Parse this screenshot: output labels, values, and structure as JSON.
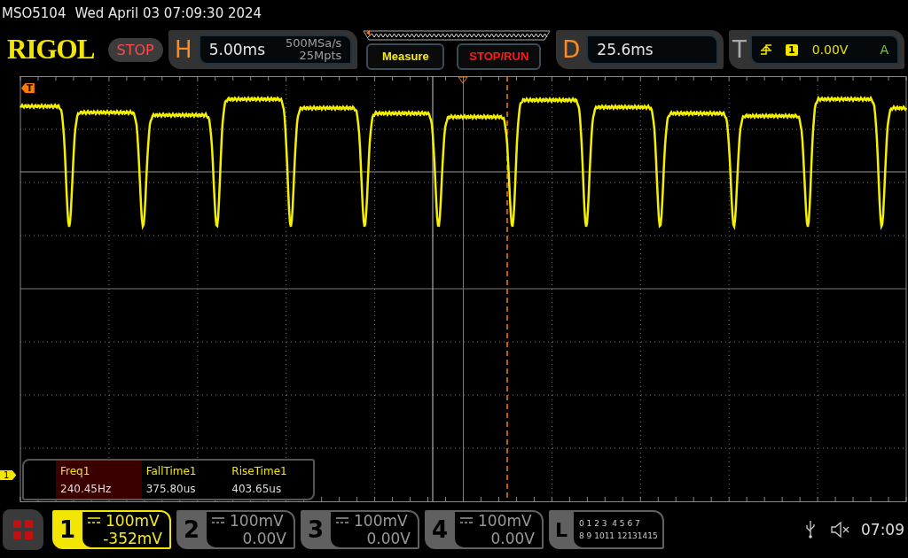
{
  "status_line": {
    "model": "MSO5104",
    "datetime": "Wed April 03 07:09:30 2024"
  },
  "logo": "RIGOL",
  "run_state": "STOP",
  "horizontal": {
    "letter": "H",
    "timebase": "5.00ms",
    "sample_rate": "500MSa/s",
    "memory_depth": "25Mpts"
  },
  "buttons": [
    "Measure",
    "STOP/RUN"
  ],
  "delay": {
    "letter": "D",
    "value": "25.6ms"
  },
  "trigger": {
    "letter": "T",
    "source": "1",
    "level": "0.00V",
    "mode": "A"
  },
  "markers": {
    "trigger": "T",
    "channel": "1"
  },
  "measurements": [
    {
      "name": "Freq1",
      "value": "240.45Hz",
      "selected": true
    },
    {
      "name": "FallTime1",
      "value": "375.80us",
      "selected": false
    },
    {
      "name": "RiseTime1",
      "value": "403.65us",
      "selected": false
    }
  ],
  "channels": [
    {
      "number": "1",
      "scale": "100mV",
      "offset": "-352mV",
      "selected": true
    },
    {
      "number": "2",
      "scale": "100mV",
      "offset": "0.00V",
      "selected": false
    },
    {
      "number": "3",
      "scale": "100mV",
      "offset": "0.00V",
      "selected": false
    },
    {
      "number": "4",
      "scale": "100mV",
      "offset": "0.00V",
      "selected": false
    }
  ],
  "logic": {
    "letter": "L",
    "row_1": "0 1 2 3  4 5 6 7",
    "row_2": "8 9 1011 12131415"
  },
  "clock": "07:09"
}
